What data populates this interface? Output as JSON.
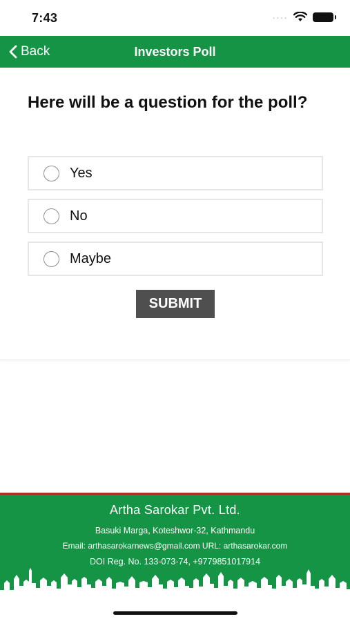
{
  "status_bar": {
    "time": "7:43",
    "signal_dots": "····",
    "icons": [
      "wifi-icon",
      "battery-icon"
    ]
  },
  "nav": {
    "back_label": "Back",
    "title": "Investors Poll",
    "color": "#149444"
  },
  "poll": {
    "question": "Here will be a question for the poll?",
    "options": [
      {
        "label": "Yes",
        "selected": false
      },
      {
        "label": "No",
        "selected": false
      },
      {
        "label": "Maybe",
        "selected": false
      }
    ],
    "submit_label": "SUBMIT",
    "submit_color": "#4f4f4f"
  },
  "footer": {
    "company": "Artha Sarokar Pvt. Ltd.",
    "address": "Basuki Marga, Koteshwor-32, Kathmandu",
    "contact": "Email: arthasarokarnews@gmail.com URL: arthasarokar.com",
    "registration": "DOI Reg. No. 133-073-74, +9779851017914",
    "background_color": "#149444",
    "accent_color": "#b42b2b"
  }
}
